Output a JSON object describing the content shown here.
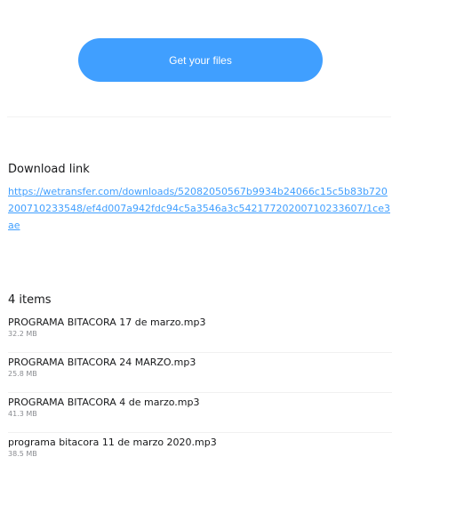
{
  "cta": {
    "label": "Get your files",
    "color": "#409fff"
  },
  "download": {
    "title": "Download link",
    "url": "https://wetransfer.com/downloads/52082050567b9934b24066c15c5b83b720200710233548/ef4d007a942fdc94c5a3546a3c54217720200710233607/1ce3ae"
  },
  "items": {
    "title": "4 items",
    "files": [
      {
        "name": "PROGRAMA BITACORA 17 de marzo.mp3",
        "size": "32.2 MB"
      },
      {
        "name": "PROGRAMA BITACORA 24 MARZO.mp3",
        "size": "25.8 MB"
      },
      {
        "name": "PROGRAMA BITACORA 4 de marzo.mp3",
        "size": "41.3 MB"
      },
      {
        "name": "programa bitacora 11 de marzo 2020.mp3",
        "size": "38.5 MB"
      }
    ]
  },
  "colors": {
    "link": "#409fff",
    "text": "#17181a",
    "muted": "#8a8c91"
  }
}
